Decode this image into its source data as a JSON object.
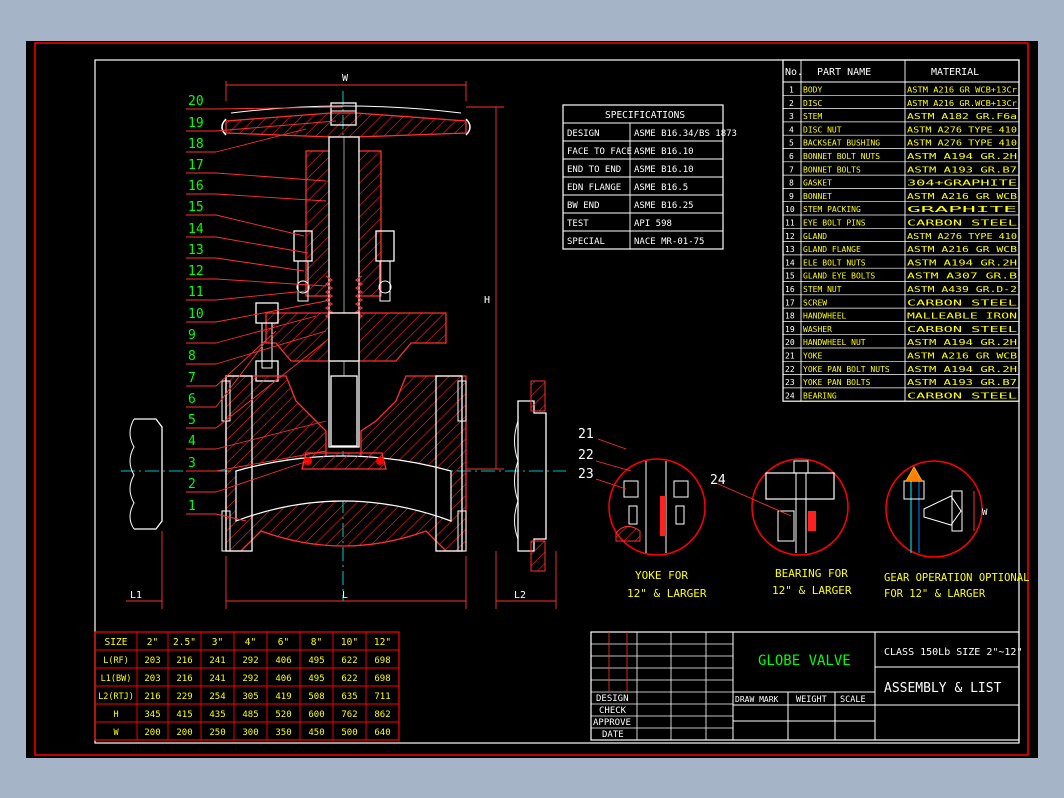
{
  "drawing": {
    "callouts": [
      "20",
      "19",
      "18",
      "17",
      "16",
      "15",
      "14",
      "13",
      "12",
      "11",
      "10",
      "9",
      "8",
      "7",
      "6",
      "5",
      "4",
      "3",
      "2",
      "1"
    ],
    "dim_w": "W",
    "dim_h": "H",
    "dim_l": "L",
    "dim_l1": "L1",
    "dim_l2": "L2"
  },
  "specifications": {
    "title": "SPECIFICATIONS",
    "rows": [
      [
        "DESIGN",
        "ASME B16.34/BS 1873"
      ],
      [
        "FACE TO FACE",
        "ASME B16.10"
      ],
      [
        "END TO END",
        "ASME B16.10"
      ],
      [
        "EDN FLANGE",
        "ASME B16.5"
      ],
      [
        "BW END",
        "ASME B16.25"
      ],
      [
        "TEST",
        "API 598"
      ],
      [
        "SPECIAL",
        "NACE MR-01-75"
      ]
    ]
  },
  "parts_list": {
    "headers": [
      "No.",
      "PART NAME",
      "MATERIAL"
    ],
    "rows": [
      [
        "1",
        "BODY",
        "ASTM A216 GR WCB+13Cr"
      ],
      [
        "2",
        "DISC",
        "ASTM A216 GR.WCB+13Cr"
      ],
      [
        "3",
        "STEM",
        "ASTM A182 GR.F6a"
      ],
      [
        "4",
        "DISC NUT",
        "ASTM A276 TYPE 410"
      ],
      [
        "5",
        "BACKSEAT BUSHING",
        "ASTM A276 TYPE 410"
      ],
      [
        "6",
        "BONNET BOLT NUTS",
        "ASTM A194 GR.2H"
      ],
      [
        "7",
        "BONNET BOLTS",
        "ASTM A193 GR.B7"
      ],
      [
        "8",
        "GASKET",
        "304+GRAPHITE"
      ],
      [
        "9",
        "BONNET",
        "ASTM A216 GR WCB"
      ],
      [
        "10",
        "STEM PACKING",
        "GRAPHITE"
      ],
      [
        "11",
        "EYE BOLT PINS",
        "CARBON STEEL"
      ],
      [
        "12",
        "GLAND",
        "ASTM A276 TYPE 410"
      ],
      [
        "13",
        "GLAND FLANGE",
        "ASTM A216 GR WCB"
      ],
      [
        "14",
        "ELE BOLT NUTS",
        "ASTM A194 GR.2H"
      ],
      [
        "15",
        "GLAND EYE BOLTS",
        "ASTM A307 GR.B"
      ],
      [
        "16",
        "STEM NUT",
        "ASTM A439 GR.D-2"
      ],
      [
        "17",
        "SCREW",
        "CARBON STEEL"
      ],
      [
        "18",
        "HANDWHEEL",
        "MALLEABLE IRON"
      ],
      [
        "19",
        "WASHER",
        "CARBON STEEL"
      ],
      [
        "20",
        "HANDWHEEL NUT",
        "ASTM A194 GR.2H"
      ],
      [
        "21",
        "YOKE",
        "ASTM A216 GR WCB"
      ],
      [
        "22",
        "YOKE PAN BOLT NUTS",
        "ASTM A194 GR.2H"
      ],
      [
        "23",
        "YOKE PAN BOLTS",
        "ASTM A193 GR.B7"
      ],
      [
        "24",
        "BEARING",
        "CARBON STEEL"
      ]
    ]
  },
  "details": {
    "callouts": [
      "21",
      "22",
      "23",
      "24"
    ],
    "yoke_caption": [
      "YOKE FOR",
      "12\" & LARGER"
    ],
    "bearing_caption": [
      "BEARING FOR",
      "12\" & LARGER"
    ],
    "gear_caption": [
      "GEAR OPERATION OPTIONAL",
      "FOR 12\" & LARGER"
    ],
    "gear_dim": "W"
  },
  "size_table": {
    "headers": [
      "SIZE",
      "2\"",
      "2.5\"",
      "3\"",
      "4\"",
      "6\"",
      "8\"",
      "10\"",
      "12\""
    ],
    "rows": [
      [
        "L(RF)",
        "203",
        "216",
        "241",
        "292",
        "406",
        "495",
        "622",
        "698"
      ],
      [
        "L1(BW)",
        "203",
        "216",
        "241",
        "292",
        "406",
        "495",
        "622",
        "698"
      ],
      [
        "L2(RTJ)",
        "216",
        "229",
        "254",
        "305",
        "419",
        "508",
        "635",
        "711"
      ],
      [
        "H",
        "345",
        "415",
        "435",
        "485",
        "520",
        "600",
        "762",
        "862"
      ],
      [
        "W",
        "200",
        "200",
        "250",
        "300",
        "350",
        "450",
        "500",
        "640"
      ]
    ]
  },
  "title_block": {
    "name": "GLOBE VALVE",
    "class_size": "CLASS 150Lb SIZE 2\"~12\"",
    "subtitle": "ASSEMBLY & LIST",
    "signoff": [
      "DESIGN",
      "CHECK",
      "APPROVE",
      "DATE"
    ],
    "cols": [
      "DRAW MARK",
      "WEIGHT",
      "SCALE"
    ]
  },
  "colors": {
    "background": "#000000",
    "frame": "#ff0000",
    "text": "#ffffff",
    "callout": "#00ff00",
    "hatch": "#ff0000",
    "centerline": "#00ffff"
  }
}
